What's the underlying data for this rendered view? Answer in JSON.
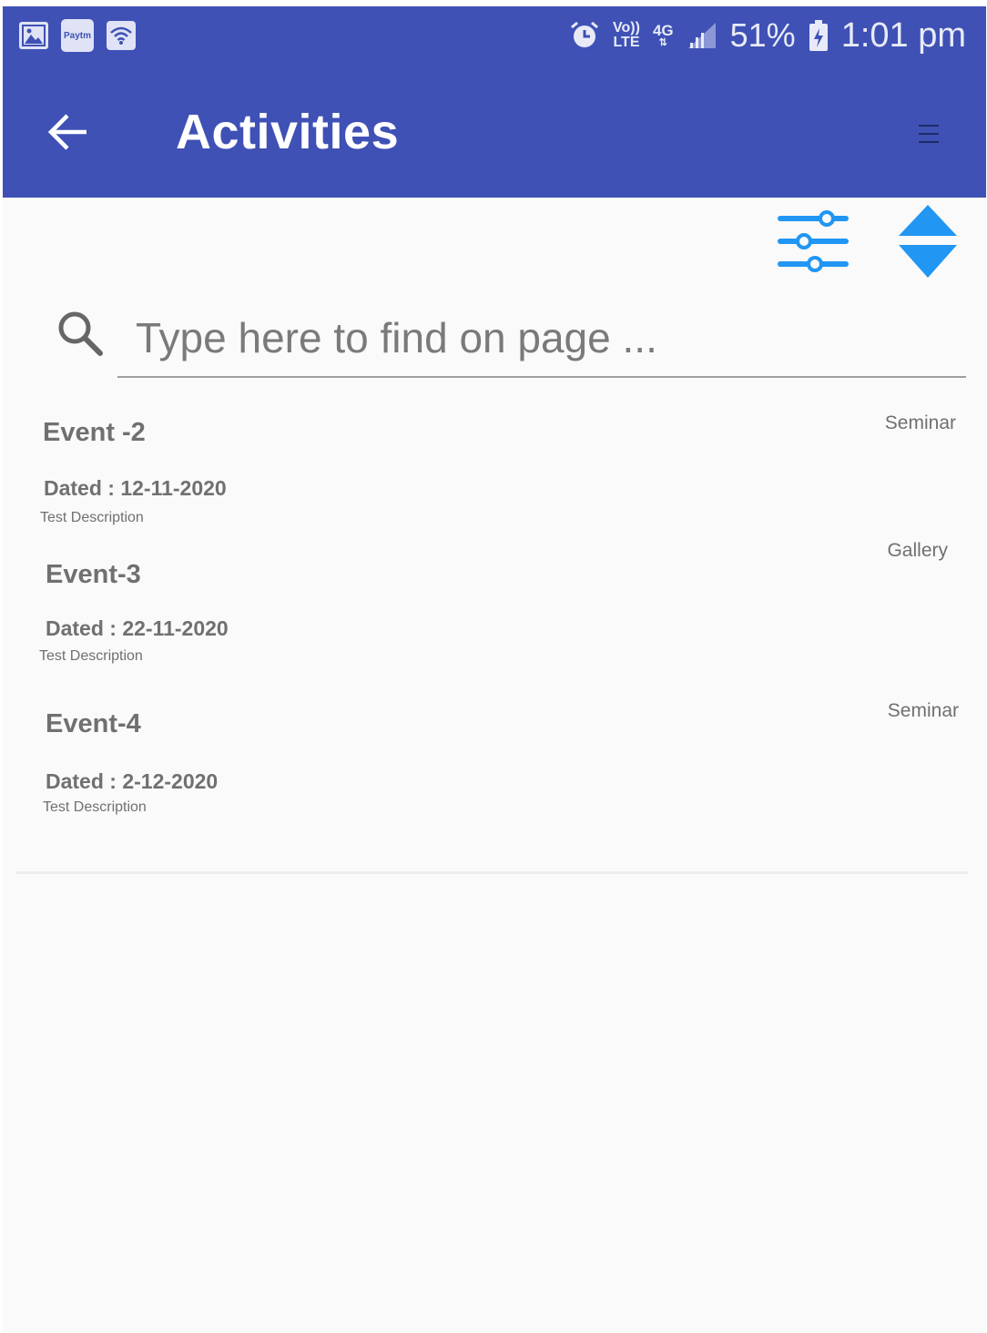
{
  "status_bar": {
    "paytm_label": "Paytm",
    "volte_top": "Vo))",
    "volte_bottom": "LTE",
    "network": "4G",
    "battery": "51%",
    "time": "1:01 pm"
  },
  "app_bar": {
    "title": "Activities"
  },
  "search": {
    "placeholder": "Type here to find on page ..."
  },
  "events": [
    {
      "title": "Event -2",
      "date": "Dated : 12-11-2020",
      "description": "Test Description",
      "category": "Seminar"
    },
    {
      "title": "Event-3",
      "date": "Dated : 22-11-2020",
      "description": "Test Description",
      "category": "Gallery"
    },
    {
      "title": "Event-4",
      "date": "Dated : 2-12-2020",
      "description": "Test Description",
      "category": "Seminar"
    }
  ],
  "colors": {
    "primary": "#3f51b5",
    "accent": "#2196f3",
    "text_muted": "#707070",
    "background": "#fafafa"
  }
}
